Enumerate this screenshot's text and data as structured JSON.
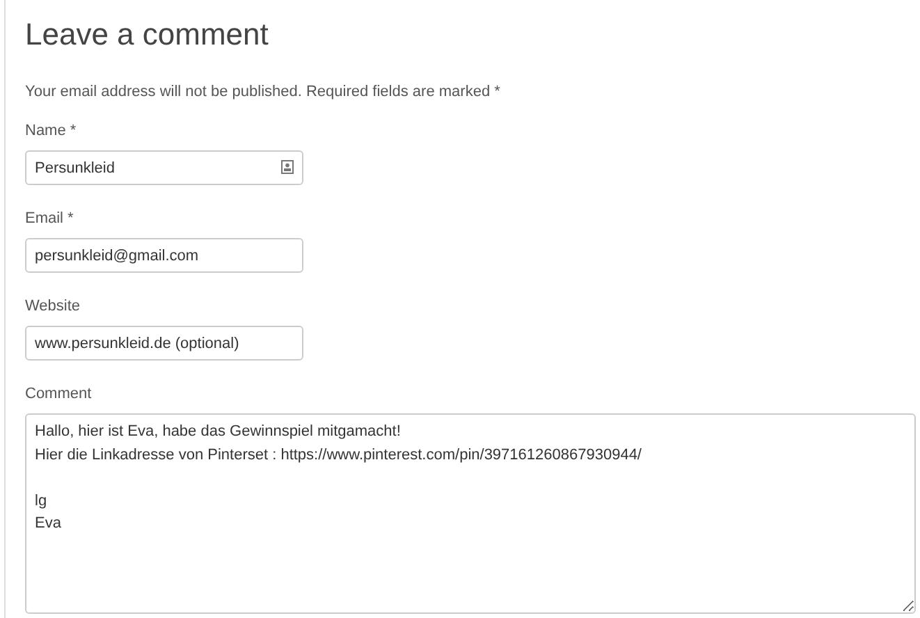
{
  "heading": "Leave a comment",
  "note": "Your email address will not be published. Required fields are marked *",
  "fields": [
    {
      "label": "Name *",
      "value": "Persunkleid",
      "kind": "text",
      "autofill_icon": true
    },
    {
      "label": "Email *",
      "value": "persunkleid@gmail.com",
      "kind": "text",
      "autofill_icon": false
    },
    {
      "label": "Website",
      "value": "www.persunkleid.de (optional)",
      "kind": "text",
      "autofill_icon": false
    },
    {
      "label": "Comment",
      "value": "Hallo, hier ist Eva, habe das Gewinnspiel mitgamacht!\nHier die Linkadresse von Pinterset : https://www.pinterest.com/pin/397161260867930944/\n\nlg\nEva",
      "kind": "textarea",
      "autofill_icon": false
    }
  ]
}
